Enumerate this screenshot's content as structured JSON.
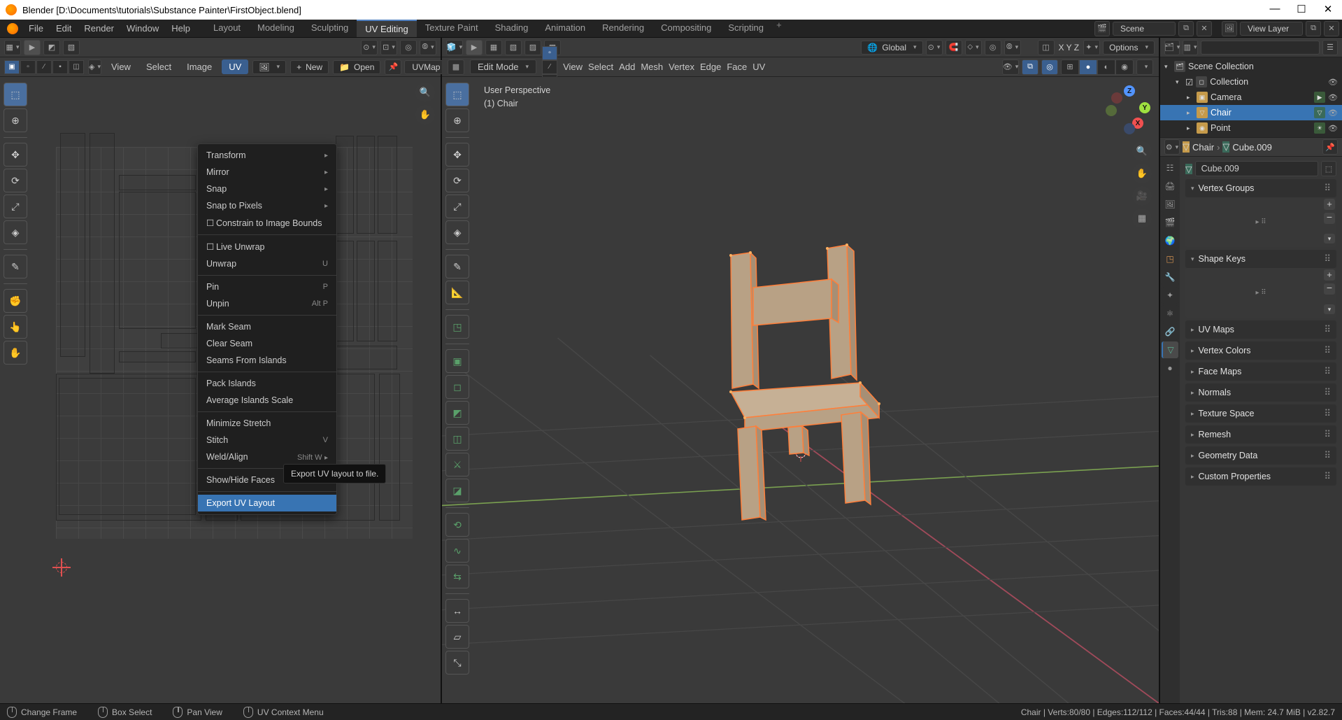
{
  "title": "Blender [D:\\Documents\\tutorials\\Substance Painter\\FirstObject.blend]",
  "menubar": {
    "items": [
      "File",
      "Edit",
      "Render",
      "Window",
      "Help"
    ],
    "tabs": [
      "Layout",
      "Modeling",
      "Sculpting",
      "UV Editing",
      "Texture Paint",
      "Shading",
      "Animation",
      "Rendering",
      "Compositing",
      "Scripting"
    ],
    "active_tab": "UV Editing",
    "scene_label": "Scene",
    "viewlayer_label": "View Layer"
  },
  "uveditor": {
    "header_menus": [
      "View",
      "Select",
      "Image",
      "UV"
    ],
    "active_menu": "UV",
    "new_label": "New",
    "open_label": "Open",
    "uvmap_label": "UVMap",
    "dropdown": {
      "items": [
        {
          "label": "Transform",
          "arrow": true
        },
        {
          "label": "Mirror",
          "arrow": true
        },
        {
          "label": "Snap",
          "arrow": true
        },
        {
          "label": "Snap to Pixels",
          "arrow": true
        },
        {
          "label": "Constrain to Image Bounds",
          "check": true,
          "sep_before": false
        },
        {
          "sep": true
        },
        {
          "label": "Live Unwrap",
          "check": true
        },
        {
          "label": "Unwrap",
          "shortcut": "U"
        },
        {
          "sep": true
        },
        {
          "label": "Pin",
          "shortcut": "P"
        },
        {
          "label": "Unpin",
          "shortcut": "Alt P"
        },
        {
          "sep": true
        },
        {
          "label": "Mark Seam"
        },
        {
          "label": "Clear Seam"
        },
        {
          "label": "Seams From Islands"
        },
        {
          "sep": true
        },
        {
          "label": "Pack Islands"
        },
        {
          "label": "Average Islands Scale"
        },
        {
          "sep": true
        },
        {
          "label": "Minimize Stretch"
        },
        {
          "label": "Stitch",
          "shortcut": "V"
        },
        {
          "label": "Weld/Align",
          "shortcut": "Shift W",
          "arrow": true
        },
        {
          "sep": true
        },
        {
          "label": "Show/Hide Faces",
          "arrow": true
        },
        {
          "sep": true
        },
        {
          "label": "Export UV Layout",
          "highlight": true
        }
      ],
      "tooltip": "Export UV layout to file."
    }
  },
  "viewport": {
    "mode": "Edit Mode",
    "menus": [
      "View",
      "Select",
      "Add",
      "Mesh",
      "Vertex",
      "Edge",
      "Face",
      "UV"
    ],
    "orientation": "Global",
    "options_label": "Options",
    "info_line1": "User Perspective",
    "info_line2": "(1) Chair"
  },
  "outliner": {
    "scene_collection": "Scene Collection",
    "rows": [
      {
        "label": "Collection",
        "indent": 1,
        "icon": "box",
        "tw": "▾"
      },
      {
        "label": "Camera",
        "indent": 2,
        "icon": "cam",
        "tw": "▸"
      },
      {
        "label": "Chair",
        "indent": 2,
        "icon": "mesh",
        "tw": "▸",
        "selected": true
      },
      {
        "label": "Point",
        "indent": 2,
        "icon": "light",
        "tw": "▸"
      }
    ]
  },
  "props": {
    "breadcrumb_chair": "Chair",
    "breadcrumb_cube": "Cube.009",
    "datablock": "Cube.009",
    "sections": {
      "vertex_groups": "Vertex Groups",
      "shape_keys": "Shape Keys",
      "uv_maps": "UV Maps",
      "vertex_colors": "Vertex Colors",
      "face_maps": "Face Maps",
      "normals": "Normals",
      "texture_space": "Texture Space",
      "remesh": "Remesh",
      "geometry_data": "Geometry Data",
      "custom_properties": "Custom Properties"
    }
  },
  "statusbar": {
    "change_frame": "Change Frame",
    "box_select": "Box Select",
    "pan_view": "Pan View",
    "context_menu": "UV Context Menu",
    "right": "Chair | Verts:80/80 | Edges:112/112 | Faces:44/44 | Tris:88 | Mem: 24.7 MiB | v2.82.7"
  }
}
